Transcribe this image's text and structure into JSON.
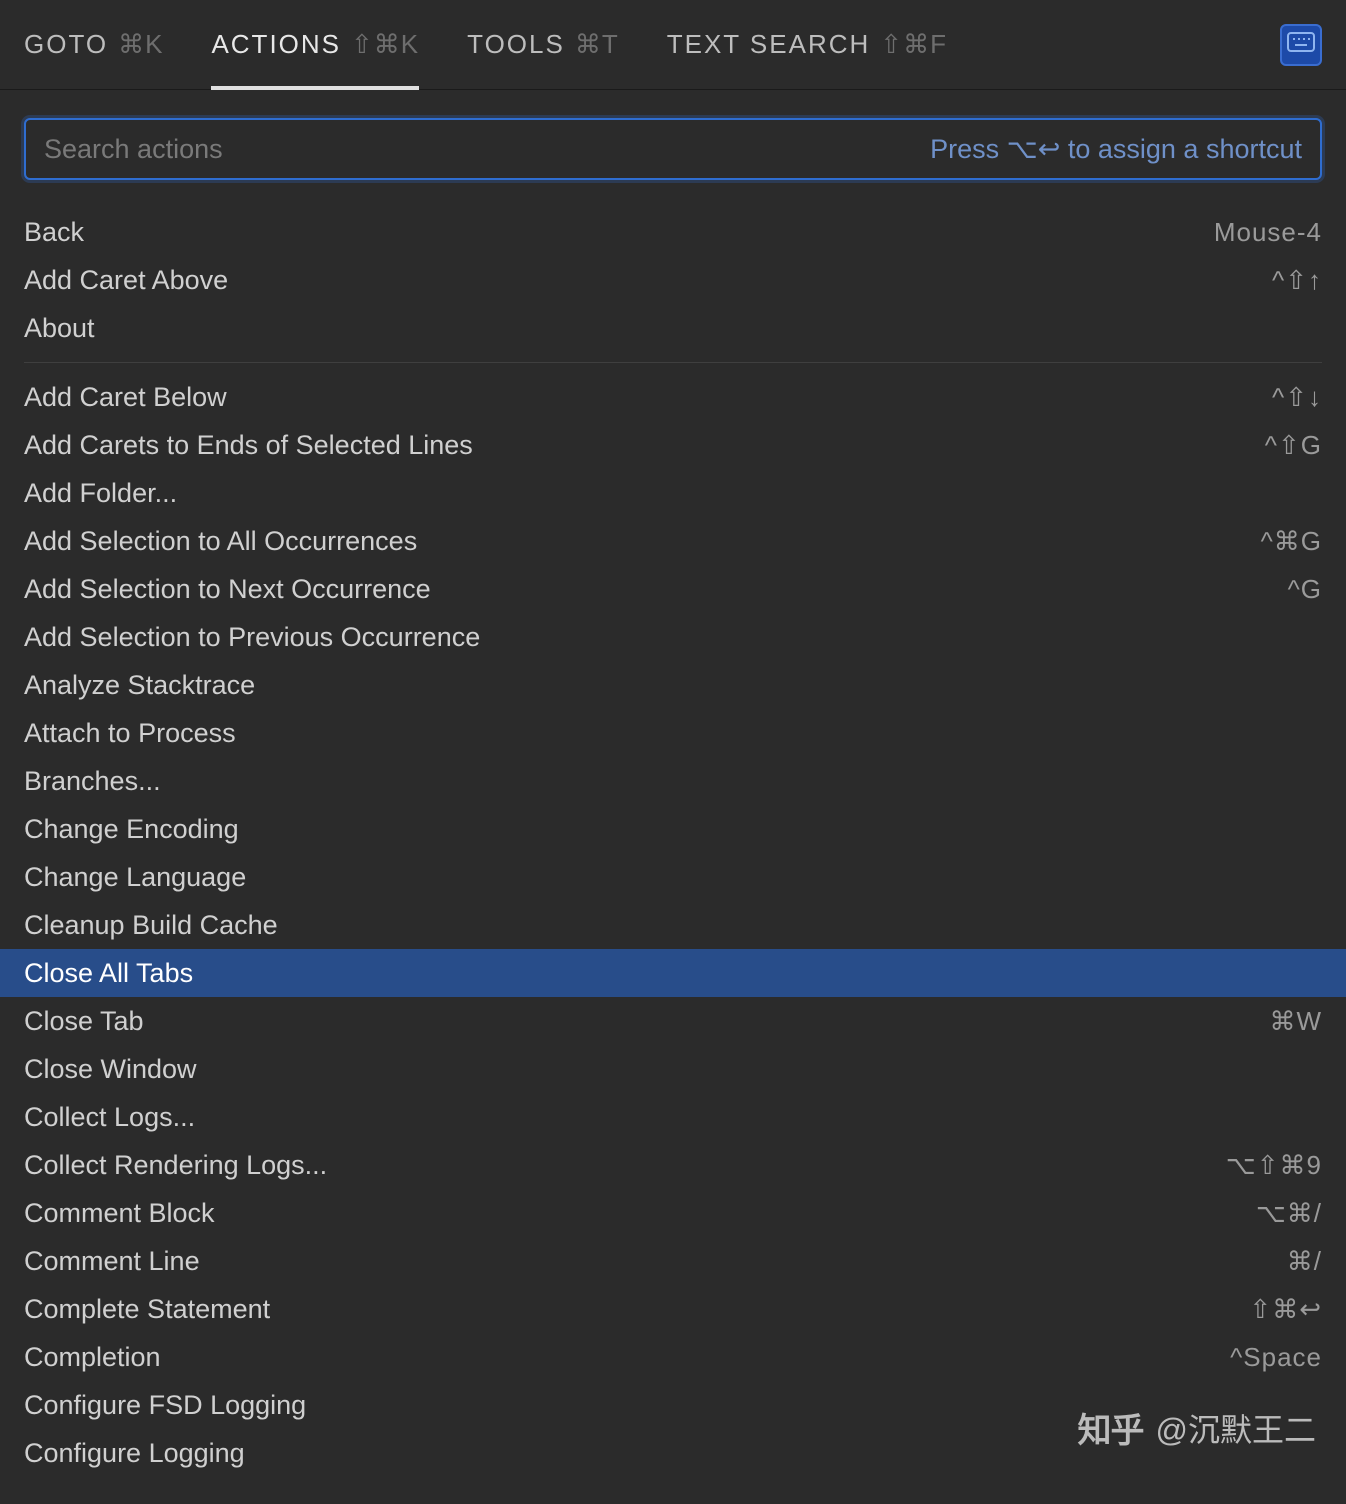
{
  "tabs": [
    {
      "label": "GOTO",
      "shortcut": "⌘K",
      "active": false
    },
    {
      "label": "ACTIONS",
      "shortcut": "⇧⌘K",
      "active": true
    },
    {
      "label": "TOOLS",
      "shortcut": "⌘T",
      "active": false
    },
    {
      "label": "TEXT SEARCH",
      "shortcut": "⇧⌘F",
      "active": false
    }
  ],
  "search": {
    "placeholder": "Search actions",
    "hint": "Press ⌥↩ to assign a shortcut"
  },
  "group1": [
    {
      "label": "Back",
      "shortcut": "Mouse-4"
    },
    {
      "label": "Add Caret Above",
      "shortcut": "^⇧↑"
    },
    {
      "label": "About",
      "shortcut": ""
    }
  ],
  "group2": [
    {
      "label": "Add Caret Below",
      "shortcut": "^⇧↓"
    },
    {
      "label": "Add Carets to Ends of Selected Lines",
      "shortcut": "^⇧G"
    },
    {
      "label": "Add Folder...",
      "shortcut": ""
    },
    {
      "label": "Add Selection to All Occurrences",
      "shortcut": "^⌘G"
    },
    {
      "label": "Add Selection to Next Occurrence",
      "shortcut": "^G"
    },
    {
      "label": "Add Selection to Previous Occurrence",
      "shortcut": ""
    },
    {
      "label": "Analyze Stacktrace",
      "shortcut": ""
    },
    {
      "label": "Attach to Process",
      "shortcut": ""
    },
    {
      "label": "Branches...",
      "shortcut": ""
    },
    {
      "label": "Change Encoding",
      "shortcut": ""
    },
    {
      "label": "Change Language",
      "shortcut": ""
    },
    {
      "label": "Cleanup Build Cache",
      "shortcut": ""
    },
    {
      "label": "Close All Tabs",
      "shortcut": "",
      "selected": true
    },
    {
      "label": "Close Tab",
      "shortcut": "⌘W"
    },
    {
      "label": "Close Window",
      "shortcut": ""
    },
    {
      "label": "Collect Logs...",
      "shortcut": ""
    },
    {
      "label": "Collect Rendering Logs...",
      "shortcut": "⌥⇧⌘9"
    },
    {
      "label": "Comment Block",
      "shortcut": "⌥⌘/"
    },
    {
      "label": "Comment Line",
      "shortcut": "⌘/"
    },
    {
      "label": "Complete Statement",
      "shortcut": "⇧⌘↩"
    },
    {
      "label": "Completion",
      "shortcut": "^Space"
    },
    {
      "label": "Configure FSD Logging",
      "shortcut": ""
    },
    {
      "label": "Configure Logging",
      "shortcut": ""
    }
  ],
  "watermark": {
    "logo": "知乎",
    "text": "@沉默王二"
  }
}
